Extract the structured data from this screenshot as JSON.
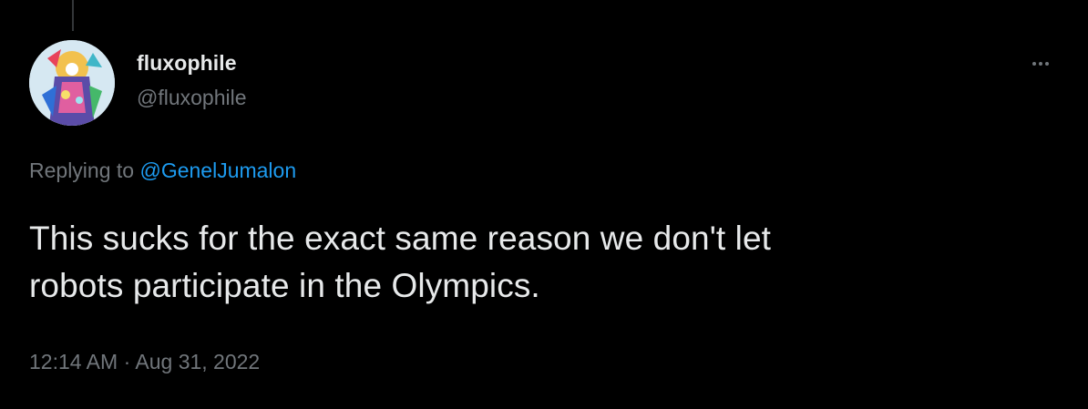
{
  "author": {
    "display_name": "fluxophile",
    "handle": "@fluxophile",
    "avatar": "colorful-figure-avatar"
  },
  "more_icon": "more-horizontal-icon",
  "reply": {
    "prefix": "Replying to",
    "mention": "@GenelJumalon"
  },
  "tweet": {
    "line1": "This sucks for the exact same reason we don't let",
    "line2": "robots participate in the Olympics."
  },
  "meta": {
    "time": "12:14 AM",
    "separator": "·",
    "date": "Aug 31, 2022"
  },
  "colors": {
    "background": "#000000",
    "text": "#e7e9ea",
    "muted": "#71767b",
    "link": "#1d9bf0"
  }
}
